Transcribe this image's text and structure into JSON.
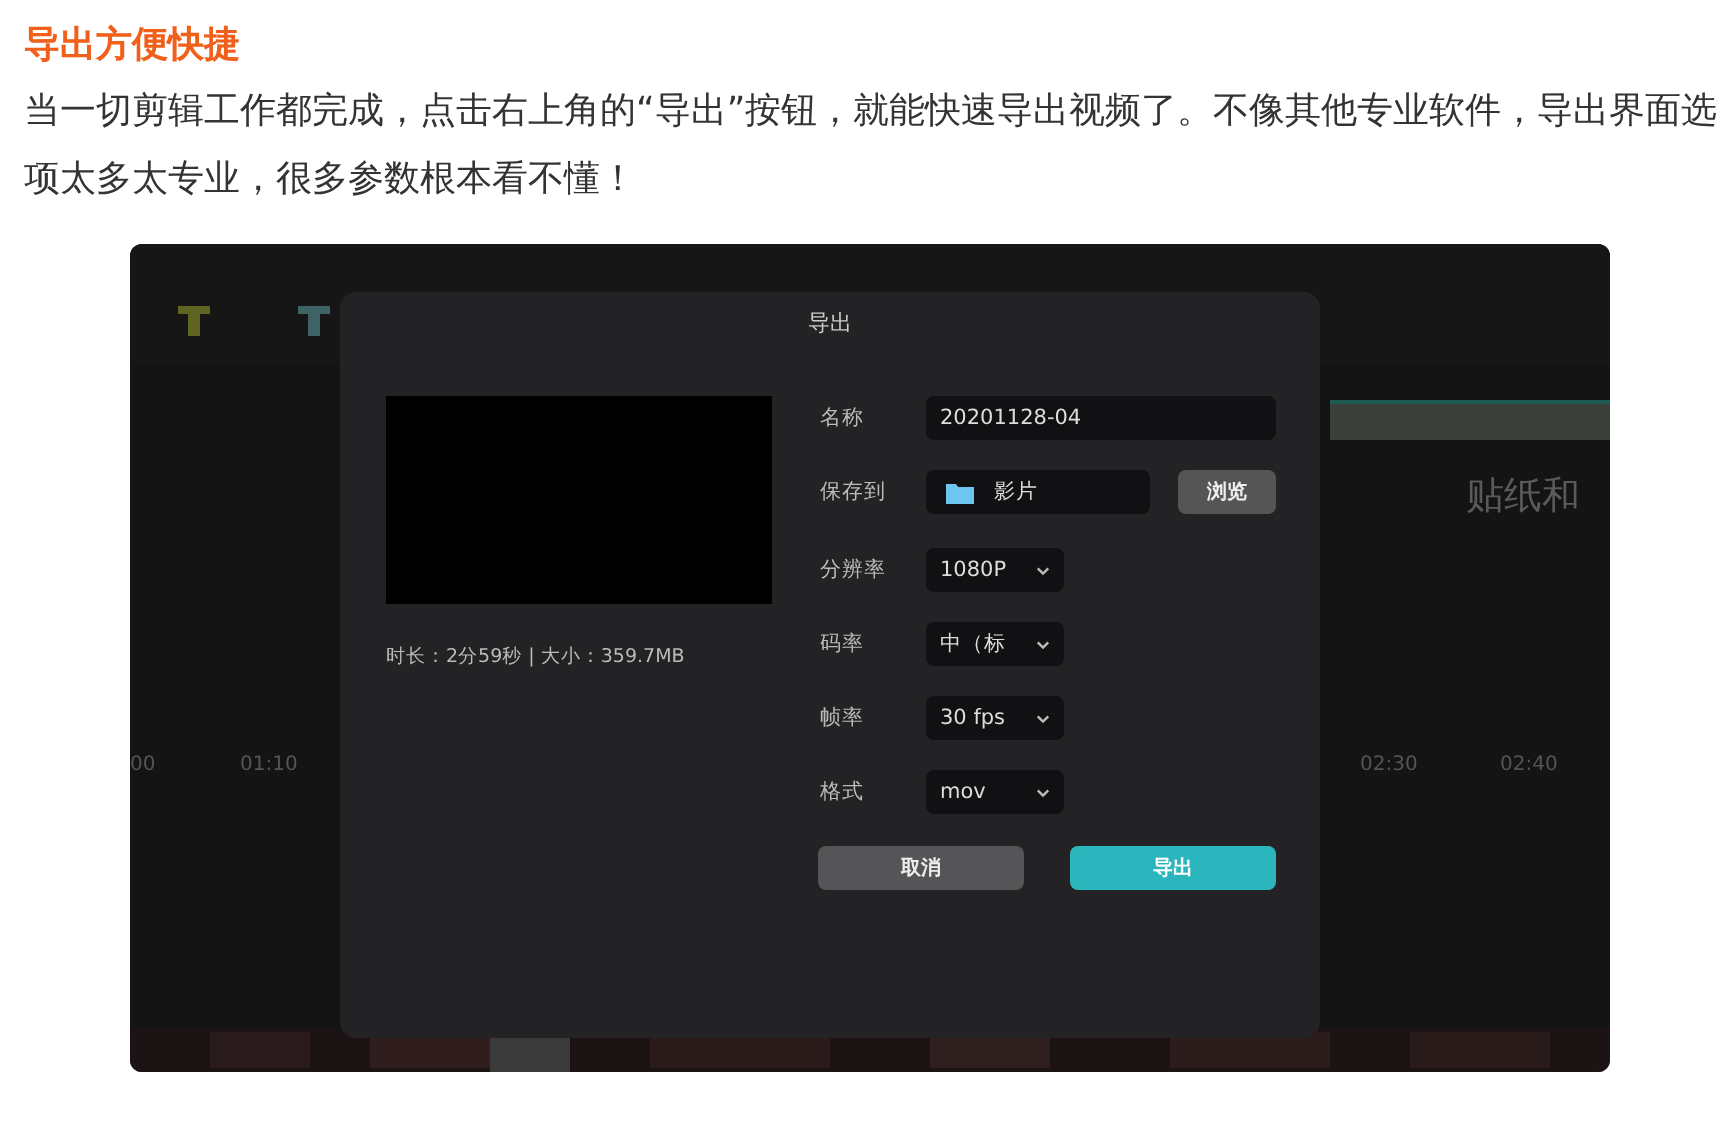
{
  "article": {
    "heading": "导出方便快捷",
    "paragraph": "当一切剪辑工作都完成，点击右上角的“导出”按钮，就能快速导出视频了。不像其他专业软件，导出界面选项太多太专业，很多参数根本看不懂！"
  },
  "background_app": {
    "panel_title": "贴纸和",
    "timeline_ticks": [
      "00",
      "01:10",
      "02:30",
      "02:40"
    ]
  },
  "dialog": {
    "title": "导出",
    "info": "时长：2分59秒 | 大小：359.7MB",
    "fields": [
      {
        "kind": "text",
        "label": "名称",
        "value": "20201128-04"
      },
      {
        "kind": "folder",
        "label": "保存到",
        "value": "影片",
        "button": "浏览"
      },
      {
        "kind": "select",
        "label": "分辨率",
        "value": "1080P"
      },
      {
        "kind": "select",
        "label": "码率",
        "value": "中（标"
      },
      {
        "kind": "select",
        "label": "帧率",
        "value": "30 fps"
      },
      {
        "kind": "select",
        "label": "格式",
        "value": "mov"
      }
    ],
    "buttons": [
      {
        "label": "取消",
        "primary": false
      },
      {
        "label": "导出",
        "primary": true
      }
    ]
  }
}
